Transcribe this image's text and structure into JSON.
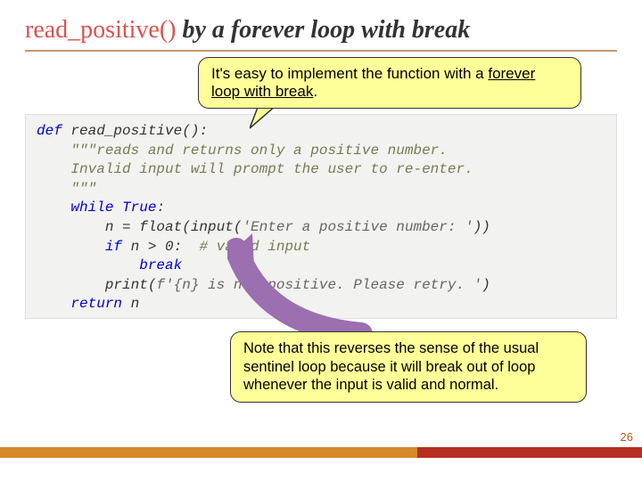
{
  "title": {
    "fn": "read_positive()",
    "rest": " by a forever loop with break"
  },
  "callout1": {
    "line1": "It's easy to implement the function with a ",
    "underlined": "forever loop with break",
    "tail": "."
  },
  "code": {
    "l0_kw": "def",
    "l0_fn": " read_positive():",
    "l1": "    \"\"\"reads and returns only a positive number.",
    "l2": "    Invalid input will prompt the user to re-enter.",
    "l3": "    \"\"\"",
    "l4_kw1": "    while",
    "l4_kw2": " True",
    "l4_rest": ":",
    "l5_a": "        n = float(input(",
    "l5_str": "'Enter a positive number: '",
    "l5_b": "))",
    "l6_kw": "        if",
    "l6_mid": " n > 0:  ",
    "l6_cmt": "# valid input",
    "l7_kw": "            break",
    "l8_a": "        print(",
    "l8_str": "f'{n} is not positive. Please retry. '",
    "l8_b": ")",
    "l9_kw": "    return",
    "l9_rest": " n"
  },
  "callout2": {
    "text": "Note that this reverses the sense of the usual sentinel loop because it will break out of loop whenever the input is valid and normal."
  },
  "page": "26"
}
